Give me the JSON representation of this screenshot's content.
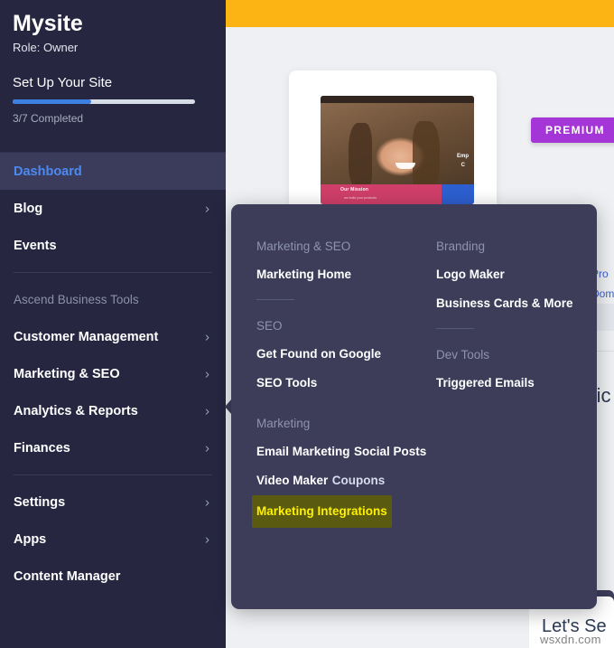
{
  "sidebar": {
    "site_title": "Mysite",
    "role": "Role: Owner",
    "setup": {
      "title": "Set Up Your Site",
      "progress_label": "3/7 Completed",
      "progress_percent": 43,
      "fill_color": "#3b7fe0"
    },
    "items": [
      {
        "label": "Dashboard",
        "type": "item",
        "active": true,
        "chevron": false
      },
      {
        "label": "Blog",
        "type": "item",
        "active": false,
        "chevron": true
      },
      {
        "label": "Events",
        "type": "item",
        "active": false,
        "chevron": false
      },
      {
        "label": "Ascend Business Tools",
        "type": "section"
      },
      {
        "label": "Customer Management",
        "type": "item",
        "active": false,
        "chevron": true
      },
      {
        "label": "Marketing & SEO",
        "type": "item",
        "active": false,
        "chevron": true
      },
      {
        "label": "Analytics & Reports",
        "type": "item",
        "active": false,
        "chevron": true
      },
      {
        "label": "Finances",
        "type": "item",
        "active": false,
        "chevron": true
      },
      {
        "label": "Settings",
        "type": "item",
        "active": false,
        "chevron": true
      },
      {
        "label": "Apps",
        "type": "item",
        "active": false,
        "chevron": true
      },
      {
        "label": "Content Manager",
        "type": "item",
        "active": false,
        "chevron": false
      }
    ]
  },
  "flyout": {
    "left_column": {
      "heading_1": "Marketing & SEO",
      "link_1": "Marketing Home",
      "heading_2": "SEO",
      "link_2": "Get Found on Google",
      "link_3": "SEO Tools",
      "heading_3": "Marketing",
      "link_4": "Email Marketing",
      "link_5": "Social Posts",
      "link_6": "Video Maker",
      "link_7": "Coupons",
      "link_8": "Marketing Integrations"
    },
    "right_column": {
      "heading_1": "Branding",
      "link_1": "Logo Maker",
      "link_2": "Business Cards & More",
      "heading_2": "Dev Tools",
      "link_3": "Triggered Emails"
    },
    "highlight_bg": "#5a5a10",
    "highlight_fg": "#fff200"
  },
  "main": {
    "top_bar_color": "#fbb414",
    "premium_badge": "PREMIUM",
    "side_link_1": "Pro",
    "side_link_2": "Dom",
    "tickets_heading": "Tic",
    "lets_sell_heading": "Let's Se",
    "watermark": "wsxdn.com",
    "thumb": {
      "caption_title": "Our Mission",
      "caption_sub": "we build your products",
      "overlay_line_1": "Emp",
      "overlay_line_2": "C"
    }
  }
}
